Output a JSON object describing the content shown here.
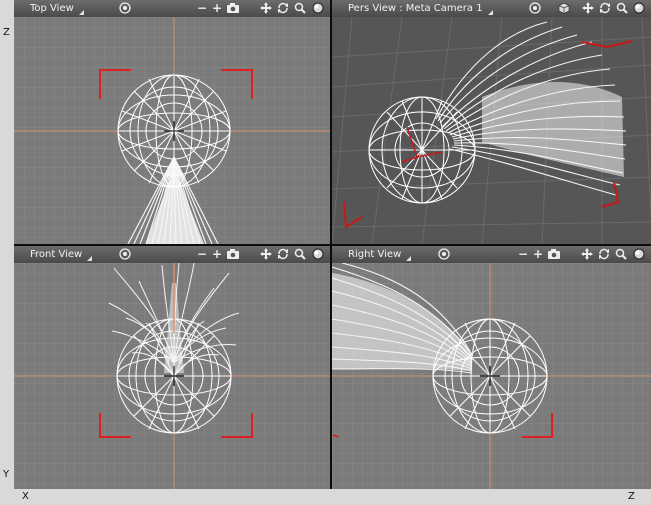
{
  "viewports": {
    "top": {
      "title": "Top View"
    },
    "persp": {
      "title": "Pers View : Meta Camera 1"
    },
    "front": {
      "title": "Front View"
    },
    "right": {
      "title": "Right View"
    }
  },
  "axis_labels": {
    "top_left_z": "Z",
    "bottom_left_y": "Y",
    "bottom_left_x": "X",
    "bottom_right_z": "Z"
  },
  "colors": {
    "viewport_bg": "#7b7b7b",
    "grid": "#8b8b8b",
    "axis": "#d89070",
    "wire": "#ffffff",
    "frame_marks": "#e02020",
    "toolbar": "#5a5a5a"
  },
  "toolbar_icons": [
    "minus-icon",
    "plus-icon",
    "camera-icon",
    "move-icon",
    "rotate-icon",
    "zoom-icon",
    "sphere-icon"
  ]
}
